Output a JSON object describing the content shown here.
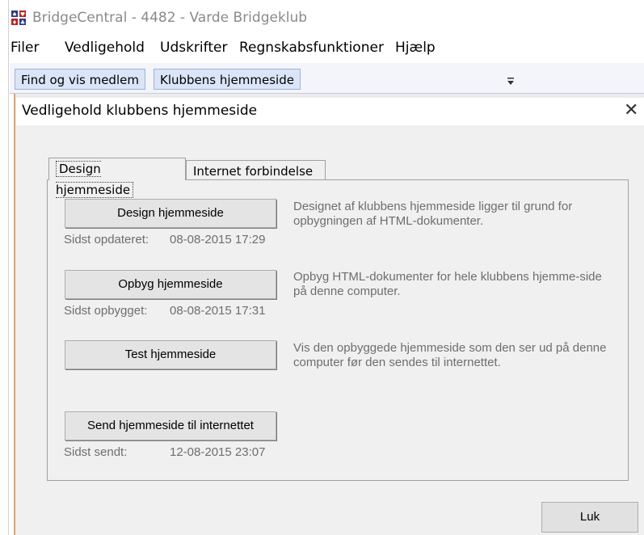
{
  "app": {
    "title": "BridgeCentral - 4482 - Varde Bridgeklub"
  },
  "menu": {
    "items": [
      {
        "label": "Filer"
      },
      {
        "label": "Vedligehold"
      },
      {
        "label": "Udskrifter"
      },
      {
        "label": "Regnskabsfunktioner"
      },
      {
        "label": "Hjælp"
      }
    ]
  },
  "dock_tabs": [
    {
      "label": "Find og vis medlem"
    },
    {
      "label": "Klubbens hjemmeside"
    }
  ],
  "dialog": {
    "title": "Vedligehold klubbens hjemmeside",
    "close_glyph": "✕",
    "tabs": [
      {
        "label": "Design hjemmeside",
        "active": true
      },
      {
        "label": "Internet forbindelse",
        "active": false
      }
    ],
    "actions": [
      {
        "button": "Design hjemmeside",
        "status_label": "Sidst opdateret:",
        "status_value": "08-08-2015 17:29",
        "description": "Designet af klubbens hjemmeside ligger til grund for opbygningen af HTML-dokumenter."
      },
      {
        "button": "Opbyg hjemmeside",
        "status_label": "Sidst opbygget:",
        "status_value": "08-08-2015 17:31",
        "description": "Opbyg HTML-dokumenter for hele klubbens hjemme-side på denne computer."
      },
      {
        "button": "Test hjemmeside",
        "status_label": "",
        "status_value": "",
        "description": "Vis den opbyggede hjemmeside som den ser ud på denne computer før den sendes til internettet."
      },
      {
        "button": "Send hjemmeside til internettet",
        "status_label": "Sidst sendt:",
        "status_value": "12-08-2015 23:07",
        "description": ""
      }
    ],
    "close_button": "Luk"
  },
  "colors": {
    "tab_bg": "#dbe5f8",
    "accent_edge": "#e0a26a",
    "title_gray": "#8a8a8a"
  }
}
